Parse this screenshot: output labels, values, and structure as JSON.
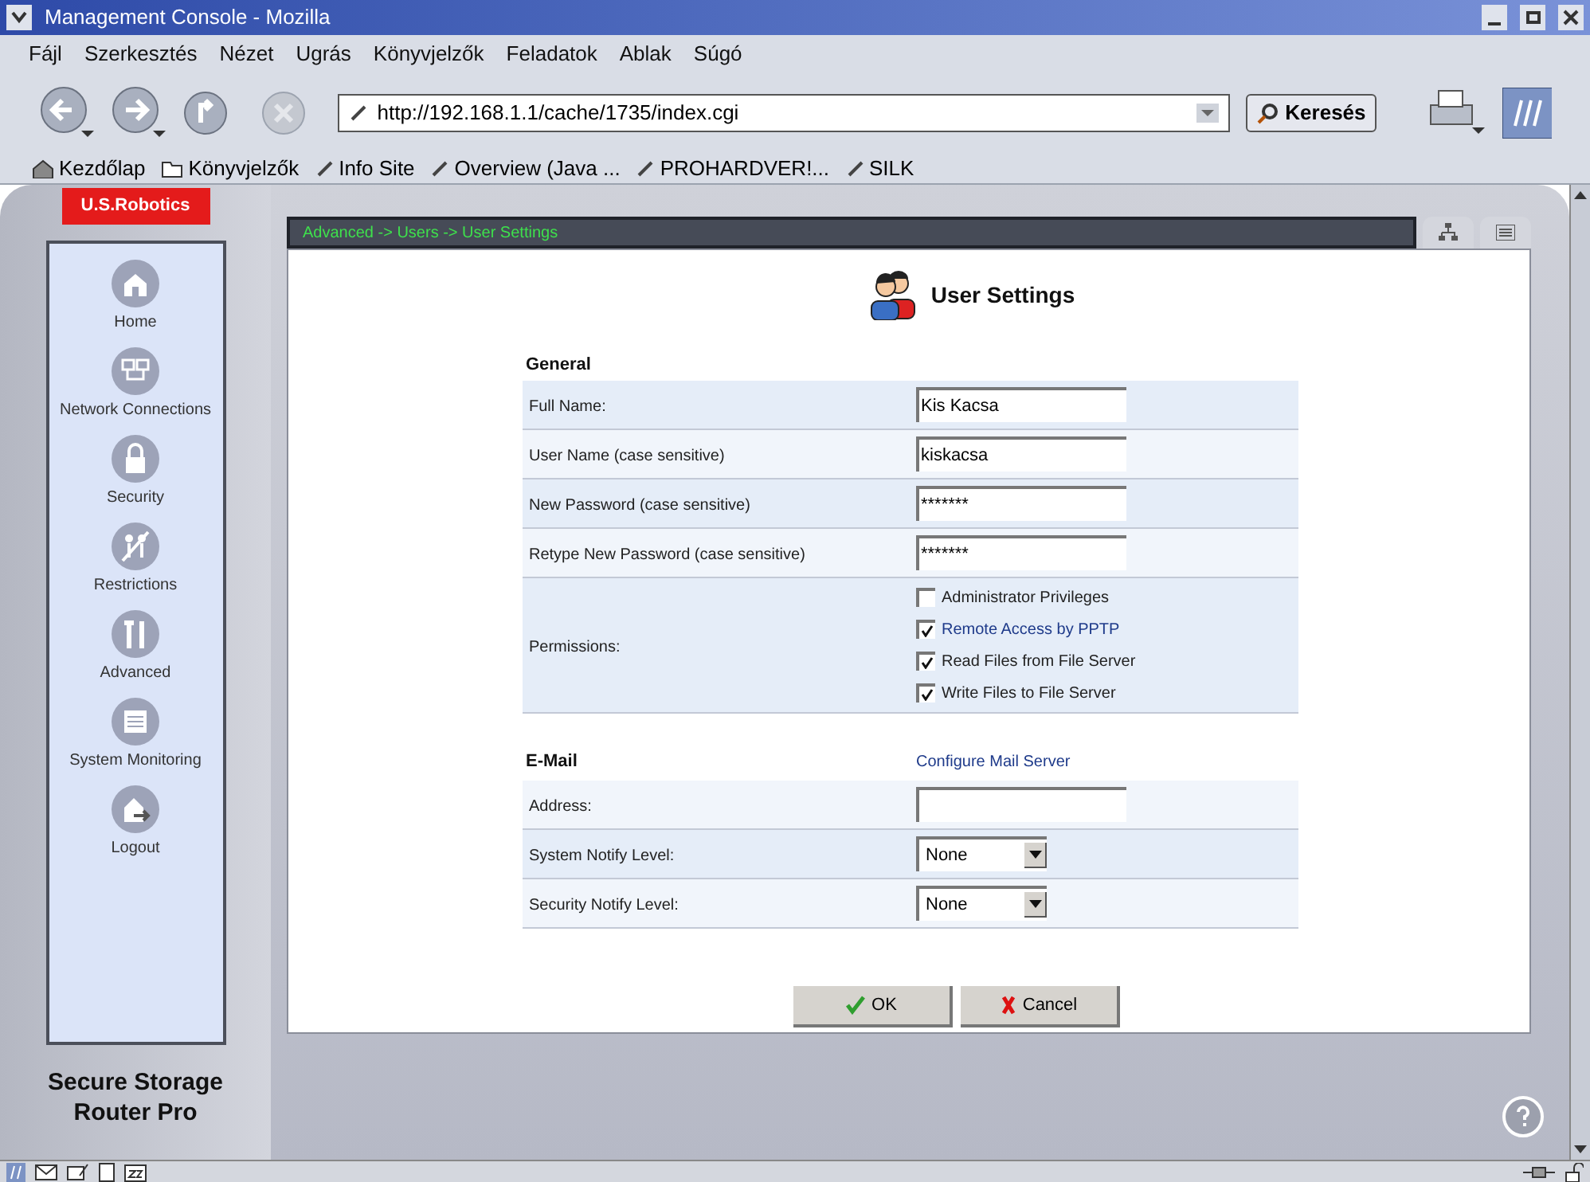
{
  "window": {
    "title": "Management Console - Mozilla"
  },
  "menu": [
    "Fájl",
    "Szerkesztés",
    "Nézet",
    "Ugrás",
    "Könyvjelzők",
    "Feladatok",
    "Ablak",
    "Súgó"
  ],
  "toolbar": {
    "url": "http://192.168.1.1/cache/1735/index.cgi",
    "search_button": "Keresés"
  },
  "bookmarks": [
    {
      "label": "Kezdőlap",
      "kind": "home"
    },
    {
      "label": "Könyvjelzők",
      "kind": "folder"
    },
    {
      "label": "Info Site",
      "kind": "link"
    },
    {
      "label": "Overview (Java ...",
      "kind": "link"
    },
    {
      "label": "PROHARDVER!...",
      "kind": "link"
    },
    {
      "label": "SILK",
      "kind": "link"
    }
  ],
  "sidebar": {
    "brand": "U.S.Robotics",
    "items": [
      {
        "label": "Home",
        "kind": "home"
      },
      {
        "label": "Network Connections",
        "kind": "network"
      },
      {
        "label": "Security",
        "kind": "lock"
      },
      {
        "label": "Restrictions",
        "kind": "restrict"
      },
      {
        "label": "Advanced",
        "kind": "tools"
      },
      {
        "label": "System Monitoring",
        "kind": "monitor"
      },
      {
        "label": "Logout",
        "kind": "logout"
      }
    ],
    "product": "Secure Storage Router Pro"
  },
  "breadcrumb": "Advanced -> Users -> User Settings",
  "page_title": "User Settings",
  "general": {
    "heading": "General",
    "fields": [
      {
        "label": "Full Name:",
        "value": "Kis Kacsa"
      },
      {
        "label": "User Name (case sensitive)",
        "value": "kiskacsa"
      },
      {
        "label": "New Password (case sensitive)",
        "value": "*******"
      },
      {
        "label": "Retype New Password (case sensitive)",
        "value": "*******"
      }
    ],
    "permissions": {
      "label": "Permissions:",
      "options": [
        {
          "label": "Administrator Privileges",
          "checked": false,
          "kind": "plain"
        },
        {
          "label": "Remote Access by PPTP",
          "checked": true,
          "kind": "link"
        },
        {
          "label": "Read Files from File Server",
          "checked": true,
          "kind": "plain"
        },
        {
          "label": "Write Files to File Server",
          "checked": true,
          "kind": "plain"
        }
      ]
    }
  },
  "email": {
    "heading": "E-Mail",
    "link": "Configure Mail Server",
    "fields": [
      {
        "label": "Address:",
        "kind": "text"
      },
      {
        "label": "System Notify Level:",
        "kind": "select",
        "value": "None"
      },
      {
        "label": "Security Notify Level:",
        "kind": "select",
        "value": "None"
      }
    ]
  },
  "buttons": {
    "ok": "OK",
    "cancel": "Cancel"
  }
}
